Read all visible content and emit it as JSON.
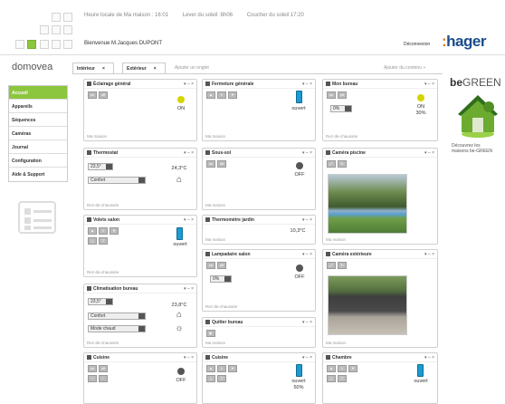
{
  "header": {
    "local_time": "Heure locale de Ma maison : 16:01",
    "sunrise": "Lever du soleil :8h06",
    "sunset": "Coucher du soleil 17:20",
    "welcome": "Bienvenue M.Jacques DUPONT",
    "logout": "Déconnexion",
    "brand_prefix": ":",
    "brand": "hager",
    "app_name": "domovea"
  },
  "tabs": [
    {
      "label": "Intérieur",
      "close": "×"
    },
    {
      "label": "Extérieur",
      "close": "×"
    }
  ],
  "add_tab": "Ajouter un onglet",
  "add_content": "Ajouter du contenu »",
  "nav": [
    "Accueil",
    "Appareils",
    "Séquences",
    "Caméras",
    "Journal",
    "Configuration",
    "Aide & Support"
  ],
  "widget_controls": "▾ – ×",
  "widgets": {
    "eclairage": {
      "title": "Éclairage général",
      "on": "on",
      "off": "off",
      "state": "ON",
      "footer": "Ma maison"
    },
    "fermeture": {
      "title": "Fermeture générale",
      "state": "ouvert",
      "footer": "Ma maison"
    },
    "bureau": {
      "title": "Mon bureau",
      "on": "on",
      "off": "off",
      "dim": "0%",
      "state": "ON",
      "level": "30%",
      "footer": "Rez-de-chaussée"
    },
    "thermostat": {
      "title": "Thermostat",
      "setpoint": "23,5°",
      "mode": "Confort",
      "temp": "24,3°C",
      "footer": "Rez-de-chaussée"
    },
    "sous_sol": {
      "title": "Sous-sol",
      "state": "OFF",
      "footer": "Ma maison"
    },
    "camera_piscine": {
      "title": "Caméra piscine",
      "footer": "Ma maison"
    },
    "volets": {
      "title": "Volets salon",
      "state": "ouvert",
      "footer": "Rez-de-chaussée"
    },
    "thermometre": {
      "title": "Thermomètre jardin",
      "temp": "10,3°C",
      "footer": "Ma maison"
    },
    "lampadaire": {
      "title": "Lampadaire salon",
      "dim": "0%",
      "state": "OFF",
      "footer": "Rez-de-chaussée"
    },
    "camera_ext": {
      "title": "Caméra extérieure",
      "footer": "Ma maison"
    },
    "clim": {
      "title": "Climatisation bureau",
      "setpoint": "23,5°",
      "mode": "Confort",
      "mode2": "Mode chaud",
      "temp": "23,8°C",
      "footer": "Rez-de-chaussée"
    },
    "quitter": {
      "title": "Quitter bureau",
      "footer": "Ma maison"
    },
    "cuisine1": {
      "title": "Cuisine",
      "on": "on",
      "off": "off",
      "state": "OFF"
    },
    "cuisine2": {
      "title": "Cuisine",
      "state": "ouvert",
      "level": "50%"
    },
    "chambre": {
      "title": "Chambre",
      "state": "ouvert"
    }
  },
  "ad": {
    "title_a": "be",
    "title_b": "GREEN",
    "desc_1": "Découvrez les",
    "desc_2": "maisons be-GREEN"
  },
  "colors": {
    "accent": "#8cc63f",
    "brand": "#1a4b8c",
    "status_on": "#d4d400",
    "status_off": "#555555",
    "shutter": "#1b9bd1"
  }
}
